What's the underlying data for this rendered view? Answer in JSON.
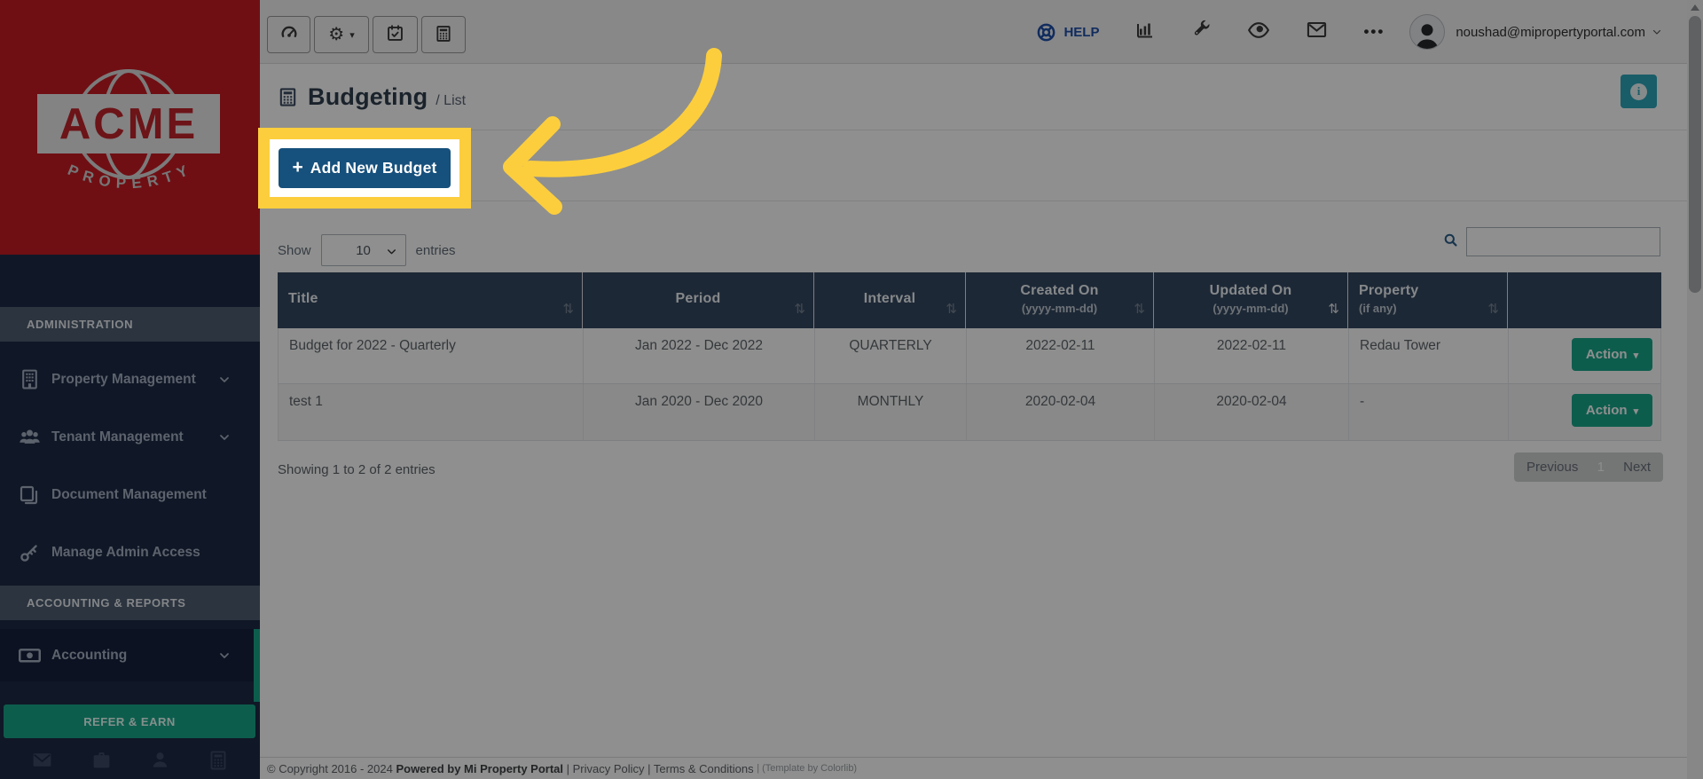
{
  "colors": {
    "brand_red": "#c61c24",
    "sidebar_navy": "#1e2945",
    "accent_green": "#18a689",
    "table_header_slate": "#344860",
    "info_teal": "#2ba7b9",
    "add_button_blue": "#16507c",
    "highlight_yellow": "#fcce3d",
    "help_blue": "#1f4fa8"
  },
  "glyphs": {
    "plus": "+",
    "caret_down": "▾",
    "sort": "⇅",
    "info": "i",
    "gear": "⚙",
    "ellipsis": "•••"
  },
  "brand": {
    "name": "ACME",
    "tagline": "PROPERTY"
  },
  "sidebar": {
    "section1_header": "ADMINISTRATION",
    "section2_header": "ACCOUNTING & REPORTS",
    "items": [
      {
        "label": "Property Management"
      },
      {
        "label": "Tenant Management"
      },
      {
        "label": "Document Management"
      },
      {
        "label": "Manage Admin Access"
      },
      {
        "label": "Accounting"
      }
    ],
    "refer_button": "REFER & EARN"
  },
  "topbar": {
    "help_label": "HELP",
    "user_email": "noushad@mipropertyportal.com"
  },
  "page": {
    "title": "Budgeting",
    "breadcrumb": "/ List"
  },
  "panel": {
    "add_button_label": "Add New Budget"
  },
  "table": {
    "show_label": "Show",
    "page_size": "10",
    "entries_label": "entries",
    "sort_glyph": "⇅",
    "columns": [
      {
        "label": "Title",
        "sub": ""
      },
      {
        "label": "Period",
        "sub": ""
      },
      {
        "label": "Interval",
        "sub": ""
      },
      {
        "label": "Created On",
        "sub": "(yyyy-mm-dd)"
      },
      {
        "label": "Updated On",
        "sub": "(yyyy-mm-dd)"
      },
      {
        "label": "Property",
        "sub": "(if any)"
      },
      {
        "label": "",
        "sub": ""
      }
    ],
    "rows": [
      {
        "title": "Budget for 2022 - Quarterly",
        "period": "Jan 2022 - Dec 2022",
        "interval": "QUARTERLY",
        "created": "2022-02-11",
        "updated": "2022-02-11",
        "property": "Redau Tower",
        "action": "Action"
      },
      {
        "title": "test 1",
        "period": "Jan 2020 - Dec 2020",
        "interval": "MONTHLY",
        "created": "2020-02-04",
        "updated": "2020-02-04",
        "property": "-",
        "action": "Action"
      }
    ],
    "summary": "Showing 1 to 2 of 2 entries",
    "pagination": {
      "previous": "Previous",
      "current": "1",
      "next": "Next"
    }
  },
  "footer": {
    "copyright": "© Copyright 2016 - 2024 ",
    "powered": "Powered by Mi Property Portal",
    "links": " | Privacy Policy | Terms & Conditions ",
    "template": "| (Template by Colorlib)"
  }
}
